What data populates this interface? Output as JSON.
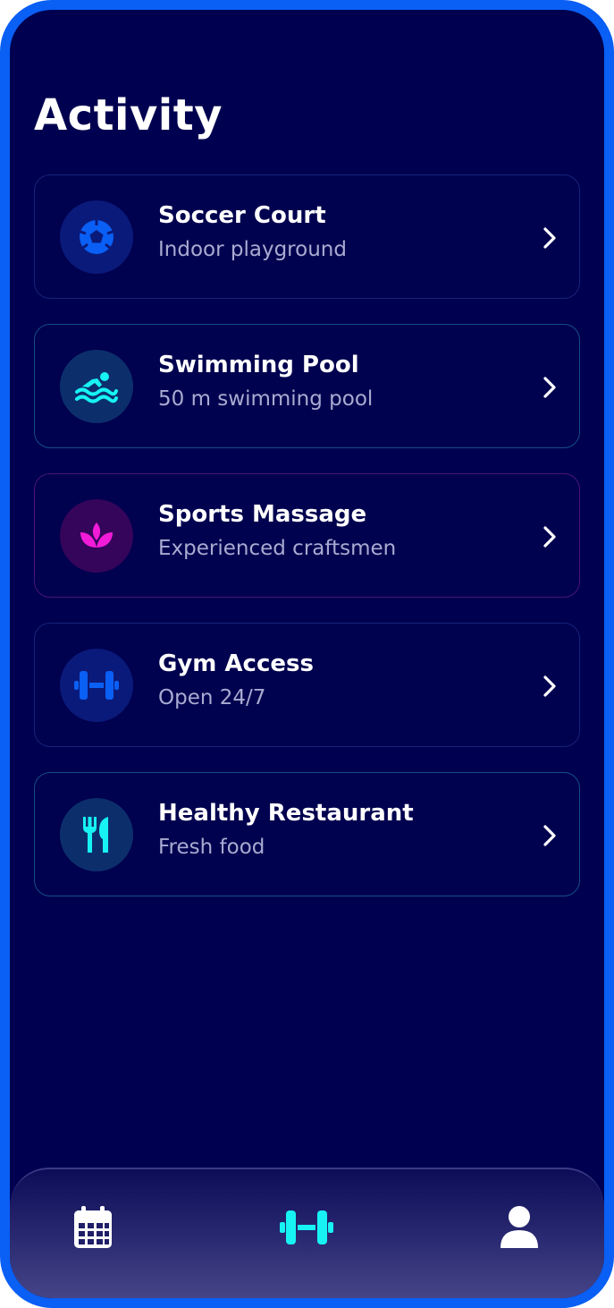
{
  "page": {
    "title": "Activity"
  },
  "activities": [
    {
      "title": "Soccer Court",
      "subtitle": "Indoor playground",
      "icon": "soccer-ball-icon",
      "accent": "#0a5ff5",
      "icon_bg": "#0a1a7a",
      "border": "#16237a"
    },
    {
      "title": "Swimming Pool",
      "subtitle": "50 m swimming pool",
      "icon": "swimmer-icon",
      "accent": "#17f3f3",
      "icon_bg": "#0c2f6c",
      "border": "#164c8a"
    },
    {
      "title": "Sports Massage",
      "subtitle": "Experienced craftsmen",
      "icon": "lotus-icon",
      "accent": "#f21bd8",
      "icon_bg": "#34055a",
      "border": "#46157a"
    },
    {
      "title": "Gym Access",
      "subtitle": "Open 24/7",
      "icon": "dumbbell-icon",
      "accent": "#0a5ff5",
      "icon_bg": "#0a1a7a",
      "border": "#16237a"
    },
    {
      "title": "Healthy Restaurant",
      "subtitle": "Fresh food",
      "icon": "utensils-icon",
      "accent": "#17f3f3",
      "icon_bg": "#0c2f6c",
      "border": "#164c8a"
    }
  ],
  "tabbar": {
    "tabs": [
      {
        "name": "calendar",
        "icon": "calendar-icon",
        "active": false
      },
      {
        "name": "gym",
        "icon": "dumbbell-icon",
        "active": true
      },
      {
        "name": "profile",
        "icon": "user-icon",
        "active": false
      }
    ],
    "active_color": "#17f3f3",
    "inactive_color": "#ffffff"
  },
  "colors": {
    "background": "#000050",
    "frame": "#0a5ff5"
  }
}
